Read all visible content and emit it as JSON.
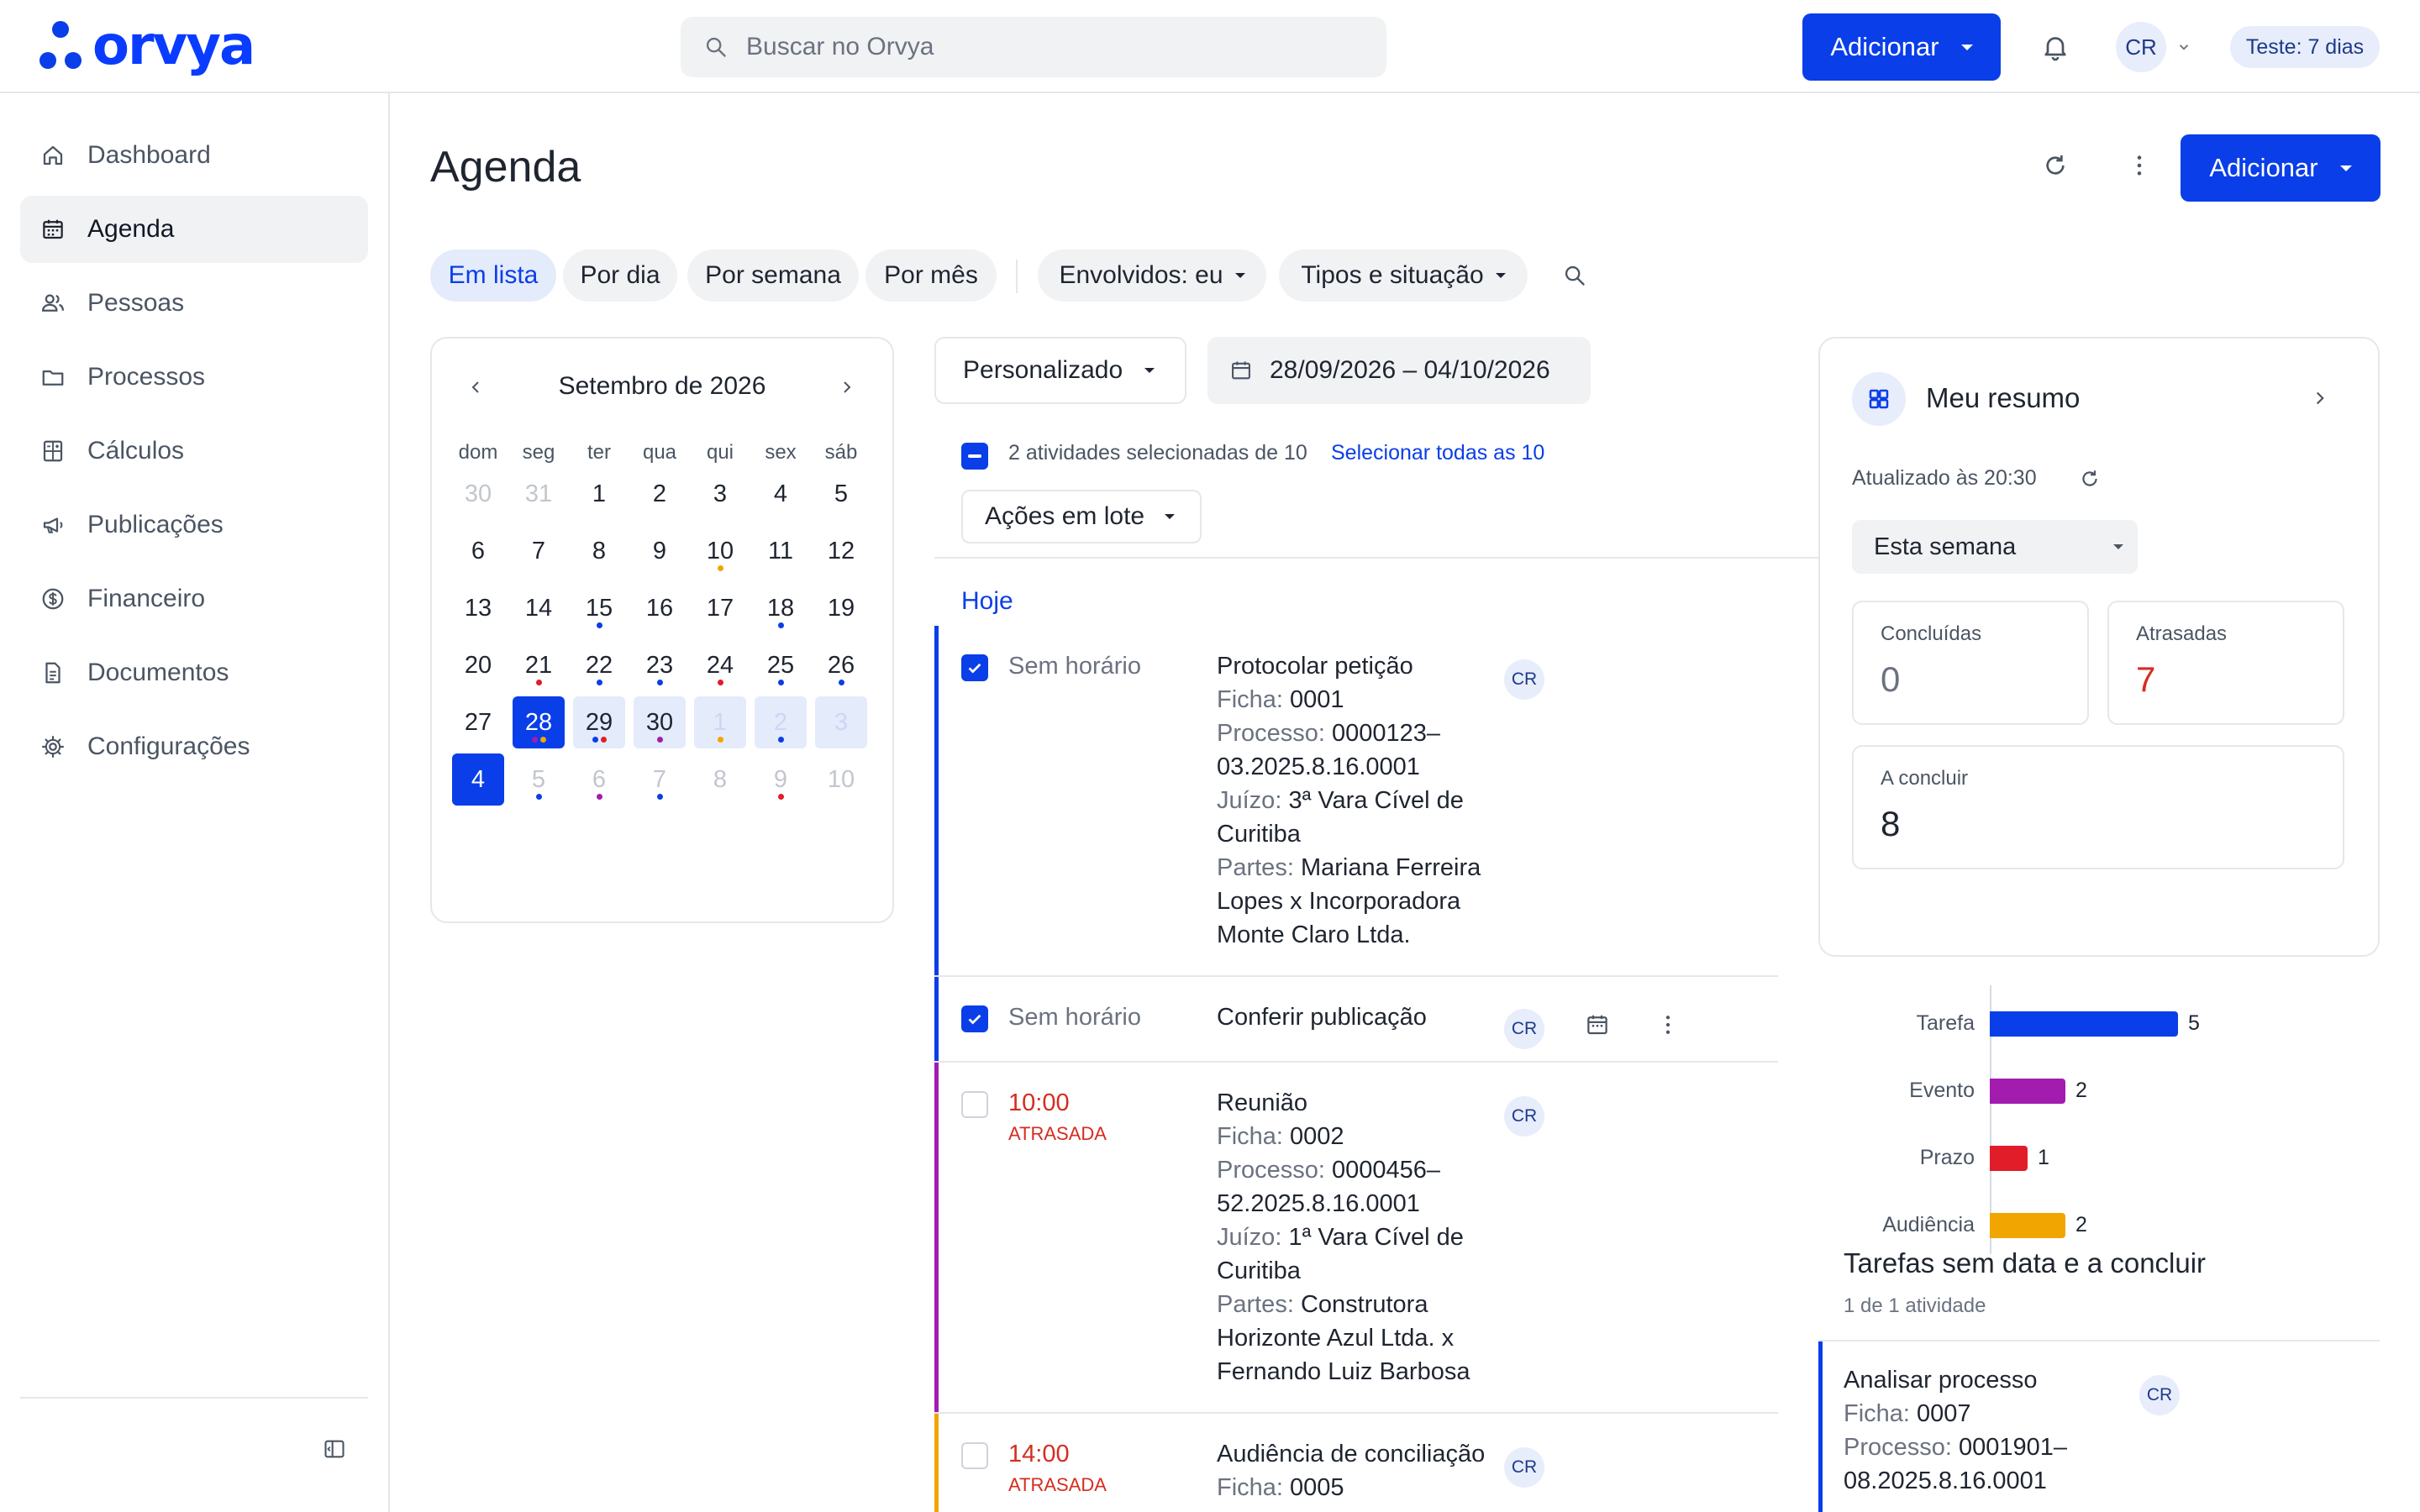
{
  "app": {
    "brand": "orvya",
    "colors": {
      "primary": "#0a3ee8",
      "danger": "#d62c1f",
      "event": "#a21caf",
      "deadline": "#e11d2a",
      "hearing": "#f0a500"
    }
  },
  "topbar": {
    "search_placeholder": "Buscar no Orvya",
    "add_label": "Adicionar",
    "user_initials": "CR",
    "trial_badge": "Teste: 7 dias"
  },
  "sidebar": {
    "items": [
      {
        "label": "Dashboard",
        "icon": "home-icon"
      },
      {
        "label": "Agenda",
        "icon": "calendar-icon",
        "active": true
      },
      {
        "label": "Pessoas",
        "icon": "people-icon"
      },
      {
        "label": "Processos",
        "icon": "folder-icon"
      },
      {
        "label": "Cálculos",
        "icon": "calculator-icon"
      },
      {
        "label": "Publicações",
        "icon": "megaphone-icon"
      },
      {
        "label": "Financeiro",
        "icon": "dollar-icon"
      },
      {
        "label": "Documentos",
        "icon": "document-icon"
      },
      {
        "label": "Configurações",
        "icon": "gear-icon"
      }
    ]
  },
  "page": {
    "title": "Agenda",
    "add_label": "Adicionar"
  },
  "view_tabs": [
    "Em lista",
    "Por dia",
    "Por semana",
    "Por mês"
  ],
  "filters": {
    "involved": "Envolvidos: eu",
    "types": "Tipos e situação"
  },
  "calendar": {
    "month_label": "Setembro de 2026",
    "weekdays": [
      "dom",
      "seg",
      "ter",
      "qua",
      "qui",
      "sex",
      "sáb"
    ],
    "weeks": [
      [
        "30",
        "31",
        "1",
        "2",
        "3",
        "4",
        "5"
      ],
      [
        "6",
        "7",
        "8",
        "9",
        "10",
        "11",
        "12"
      ],
      [
        "13",
        "14",
        "15",
        "16",
        "17",
        "18",
        "19"
      ],
      [
        "20",
        "21",
        "22",
        "23",
        "24",
        "25",
        "26"
      ],
      [
        "27",
        "28",
        "29",
        "30",
        "1",
        "2",
        "3"
      ],
      [
        "4",
        "5",
        "6",
        "7",
        "8",
        "9",
        "10"
      ]
    ]
  },
  "range": {
    "preset": "Personalizado",
    "dates": "28/09/2026 – 04/10/2026"
  },
  "selection": {
    "text": "2 atividades selecionadas de 10",
    "select_all": "Selecionar todas as 10",
    "bulk_actions": "Ações em lote"
  },
  "group_label": "Hoje",
  "activities": [
    {
      "time": "Sem horário",
      "late": "",
      "title": "Protocolar petição",
      "checked": true,
      "ficha_k": "Ficha:",
      "ficha": "0001",
      "proc_k": "Processo:",
      "proc": "0000123–03.2025.8.16.0001",
      "juizo_k": "Juízo:",
      "juizo": "3ª Vara Cível de Curitiba",
      "partes_k": "Partes:",
      "partes": "Mariana Ferreira Lopes x Incorporadora Monte Claro Ltda.",
      "assignee": "CR"
    },
    {
      "time": "Sem horário",
      "late": "",
      "title": "Conferir publicação",
      "checked": true,
      "assignee": "CR"
    },
    {
      "time": "10:00",
      "late": "ATRASADA",
      "title": "Reunião",
      "checked": false,
      "ficha_k": "Ficha:",
      "ficha": "0002",
      "proc_k": "Processo:",
      "proc": "0000456–52.2025.8.16.0001",
      "juizo_k": "Juízo:",
      "juizo": "1ª Vara Cível de Curitiba",
      "partes_k": "Partes:",
      "partes": "Construtora Horizonte Azul Ltda. x Fernando Luiz Barbosa",
      "assignee": "CR"
    },
    {
      "time": "14:00",
      "late": "ATRASADA",
      "title": "Audiência de conciliação",
      "checked": false,
      "ficha_k": "Ficha:",
      "ficha": "0005",
      "assignee": "CR"
    }
  ],
  "summary": {
    "title": "Meu resumo",
    "updated": "Atualizado às 20:30",
    "period": "Esta semana",
    "concluidas_label": "Concluídas",
    "concluidas": "0",
    "atrasadas_label": "Atrasadas",
    "atrasadas": "7",
    "aconcluir_label": "A concluir",
    "aconcluir": "8"
  },
  "chart_data": {
    "type": "bar",
    "orientation": "horizontal",
    "categories": [
      "Tarefa",
      "Evento",
      "Prazo",
      "Audiência"
    ],
    "values": [
      5,
      2,
      1,
      2
    ],
    "colors": [
      "#0a3ee8",
      "#a21caf",
      "#e11d2a",
      "#f0a500"
    ]
  },
  "undated": {
    "title": "Tarefas sem data e a concluir",
    "count": "1 de 1 atividade",
    "item": {
      "title": "Analisar processo",
      "ficha_k": "Ficha:",
      "ficha": "0007",
      "proc_k": "Processo:",
      "proc": "0001901–08.2025.8.16.0001",
      "assignee": "CR"
    }
  }
}
